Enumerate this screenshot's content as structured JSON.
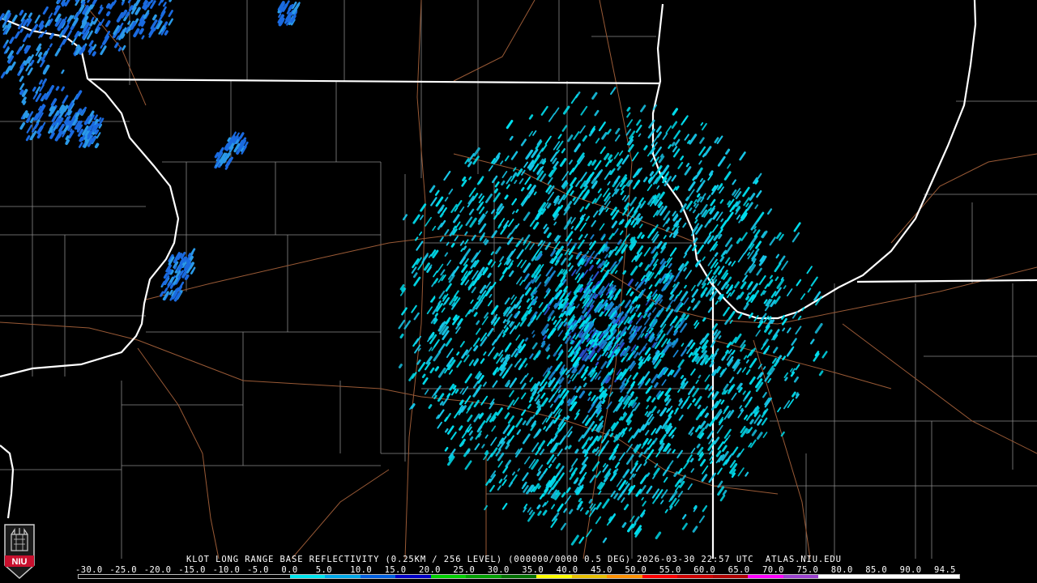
{
  "product": {
    "caption": "KLOT LONG RANGE BASE REFLECTIVITY (0.25KM / 256 LEVEL) (000000/0000 0.5 DEG) 2026-03-30 22:57 UTC  ATLAS.NIU.EDU",
    "logo_text": "NIU",
    "logo_color": "#c8102e"
  },
  "legend": {
    "ticks": [
      "-30.0",
      "-25.0",
      "-20.0",
      "-15.0",
      "-10.0",
      "-5.0",
      "0.0",
      "5.0",
      "10.0",
      "15.0",
      "20.0",
      "25.0",
      "30.0",
      "35.0",
      "40.0",
      "45.0",
      "50.0",
      "55.0",
      "60.0",
      "65.0",
      "70.0",
      "75.0",
      "80.0",
      "85.0",
      "90.0",
      "94.5"
    ],
    "colors": [
      "#000000",
      "#000000",
      "#000000",
      "#000000",
      "#000000",
      "#000000",
      "#00e5ee",
      "#00a8e8",
      "#0060e0",
      "#0000c8",
      "#00d000",
      "#00a000",
      "#007000",
      "#ffff00",
      "#e8c000",
      "#ff9000",
      "#ff0000",
      "#d00000",
      "#b00000",
      "#ff00ff",
      "#9c40d0",
      "#ffffff",
      "#ffffff",
      "#ffffff",
      "#ffffff"
    ]
  },
  "map": {
    "state_line_color": "#ffffff",
    "county_line_color": "#8a8a8a",
    "highway_color": "#9a5a36",
    "echo_colors": [
      "#00e0f0",
      "#18c8ea",
      "#1a8ad8",
      "#2a50d0"
    ]
  }
}
